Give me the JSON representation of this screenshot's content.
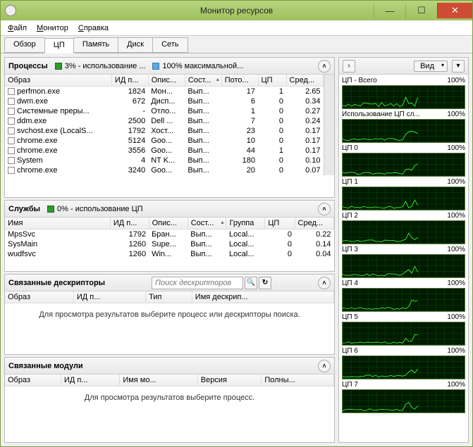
{
  "window": {
    "title": "Монитор ресурсов",
    "minimize": "—",
    "maximize": "☐",
    "close": "✕"
  },
  "menu": [
    "Файл",
    "Монитор",
    "Справка"
  ],
  "tabs": [
    "Обзор",
    "ЦП",
    "Память",
    "Диск",
    "Сеть"
  ],
  "active_tab": 1,
  "processes_panel": {
    "title": "Процессы",
    "legend1": "3% - использование ...",
    "legend2": "100% максимальной...",
    "columns": [
      "Образ",
      "ИД п...",
      "Опис...",
      "Сост...",
      "Пото...",
      "ЦП",
      "Сред..."
    ],
    "rows": [
      [
        "perfmon.exe",
        "1824",
        "Мон...",
        "Вып...",
        "17",
        "1",
        "2.65"
      ],
      [
        "dwm.exe",
        "672",
        "Дисп...",
        "Вып...",
        "6",
        "0",
        "0.34"
      ],
      [
        "Системные преры...",
        "-",
        "Отло...",
        "Вып...",
        "1",
        "0",
        "0.27"
      ],
      [
        "ddm.exe",
        "2500",
        "Dell ...",
        "Вып...",
        "7",
        "0",
        "0.24"
      ],
      [
        "svchost.exe (LocalS...",
        "1792",
        "Хост...",
        "Вып...",
        "23",
        "0",
        "0.17"
      ],
      [
        "chrome.exe",
        "5124",
        "Goo...",
        "Вып...",
        "10",
        "0",
        "0.17"
      ],
      [
        "chrome.exe",
        "3556",
        "Goo...",
        "Вып...",
        "44",
        "1",
        "0.17"
      ],
      [
        "System",
        "4",
        "NT K...",
        "Вып...",
        "180",
        "0",
        "0.10"
      ],
      [
        "chrome.exe",
        "3240",
        "Goo...",
        "Вып...",
        "20",
        "0",
        "0.07"
      ]
    ]
  },
  "services_panel": {
    "title": "Службы",
    "legend1": "0% - использование ЦП",
    "columns": [
      "Имя",
      "ИД п...",
      "Опис...",
      "Сост...",
      "Группа",
      "ЦП",
      "Сред..."
    ],
    "rows": [
      [
        "MpsSvc",
        "1792",
        "Бран...",
        "Вып...",
        "Local...",
        "0",
        "0.22"
      ],
      [
        "SysMain",
        "1260",
        "Supe...",
        "Вып...",
        "Local...",
        "0",
        "0.14"
      ],
      [
        "wudfsvc",
        "1260",
        "Win...",
        "Вып...",
        "Local...",
        "0",
        "0.04"
      ]
    ]
  },
  "handles_panel": {
    "title": "Связанные дескрипторы",
    "search_placeholder": "Поиск дескрипторов",
    "columns": [
      "Образ",
      "ИД п...",
      "Тип",
      "Имя дескрип..."
    ],
    "empty": "Для просмотра результатов выберите процесс или дескрипторы поиска."
  },
  "modules_panel": {
    "title": "Связанные модули",
    "columns": [
      "Образ",
      "ИД п...",
      "Имя мо...",
      "Версия",
      "Полны..."
    ],
    "empty": "Для просмотра результатов выберите процесс."
  },
  "sidebar": {
    "view_label": "Вид",
    "graphs": [
      {
        "label": "ЦП - Всего",
        "pct": "100%"
      },
      {
        "label": "Использование ЦП сл...",
        "pct": "100%"
      },
      {
        "label": "ЦП 0",
        "pct": "100%"
      },
      {
        "label": "ЦП 1",
        "pct": "100%"
      },
      {
        "label": "ЦП 2",
        "pct": "100%"
      },
      {
        "label": "ЦП 3",
        "pct": "100%"
      },
      {
        "label": "ЦП 4",
        "pct": "100%"
      },
      {
        "label": "ЦП 5",
        "pct": "100%"
      },
      {
        "label": "ЦП 6",
        "pct": "100%"
      },
      {
        "label": "ЦП 7",
        "pct": "100%"
      }
    ]
  }
}
